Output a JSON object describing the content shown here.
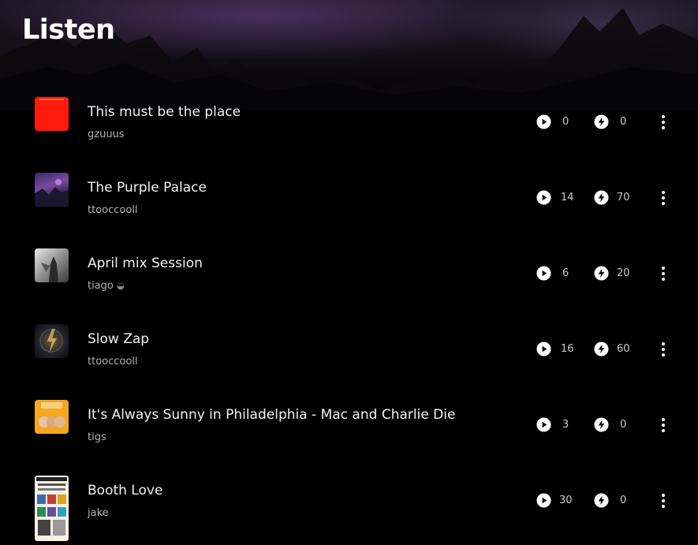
{
  "header": {
    "title": "Listen"
  },
  "tracks": [
    {
      "title": "This must be the place",
      "artist": "gzuuus",
      "plays": "0",
      "zaps": "0",
      "thumb": "red"
    },
    {
      "title": "The Purple Palace",
      "artist": "ttooccooll",
      "plays": "14",
      "zaps": "70",
      "thumb": "purple-landscape"
    },
    {
      "title": "April mix Session",
      "artist": "tiago",
      "artist_suffix": "◒",
      "plays": "6",
      "zaps": "20",
      "thumb": "grey-figure"
    },
    {
      "title": "Slow Zap",
      "artist": "ttooccooll",
      "plays": "16",
      "zaps": "60",
      "thumb": "dark-lightning"
    },
    {
      "title": "It's Always Sunny in Philadelphia - Mac and Charlie Die",
      "artist": "tigs",
      "plays": "3",
      "zaps": "0",
      "thumb": "sunny-podcast"
    },
    {
      "title": "Booth Love",
      "artist": "jake",
      "plays": "30",
      "zaps": "0",
      "thumb": "poster"
    }
  ],
  "icons": {
    "play": "play-circle-icon",
    "zap": "lightning-circle-icon",
    "more": "vertical-dots-icon"
  },
  "colors": {
    "background": "#000000",
    "text": "#ffffff",
    "muted": "#b3b3b3",
    "red_thumb": "#ff1a0d"
  }
}
